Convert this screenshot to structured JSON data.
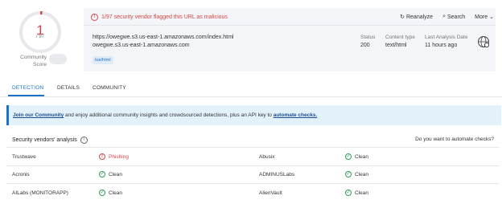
{
  "score": {
    "value": "1",
    "total": "/ 97",
    "community_label": "Community\nScore"
  },
  "alert": "1/97 security vendor flagged this URL as malicious",
  "actions": {
    "reanalyze": "Reanalyze",
    "search": "Search",
    "more": "More"
  },
  "url": {
    "full": "https://owegwe.s3.us-east-1.amazonaws.com/index.html",
    "host": "owegwe.s3.us-east-1.amazonaws.com",
    "tag": "tue/html"
  },
  "meta": {
    "status_label": "Status",
    "status_value": "200",
    "type_label": "Content type",
    "type_value": "text/html",
    "date_label": "Last Analysis Date",
    "date_value": "11 hours ago"
  },
  "tabs": [
    "DETECTION",
    "DETAILS",
    "COMMUNITY"
  ],
  "banner": {
    "link1": "Join our Community",
    "middle": " and enjoy additional community insights and crowdsourced detections, plus an API key to ",
    "link2": "automate checks."
  },
  "vendors_title": "Security vendors' analysis",
  "automate_prompt": "Do you want to automate checks?",
  "vendors": [
    {
      "left": {
        "name": "Trustwave",
        "result": "Phishing",
        "status": "malicious"
      },
      "right": {
        "name": "Abusix",
        "result": "Clean",
        "status": "clean"
      }
    },
    {
      "left": {
        "name": "Acronis",
        "result": "Clean",
        "status": "clean"
      },
      "right": {
        "name": "ADMINUSLabs",
        "result": "Clean",
        "status": "clean"
      }
    },
    {
      "left": {
        "name": "AILabs (MONITORAPP)",
        "result": "Clean",
        "status": "clean"
      },
      "right": {
        "name": "AlienVault",
        "result": "Clean",
        "status": "clean"
      }
    }
  ],
  "colors": {
    "accent": "#1a73c8",
    "danger": "#d64545",
    "ok": "#2e9e57"
  }
}
